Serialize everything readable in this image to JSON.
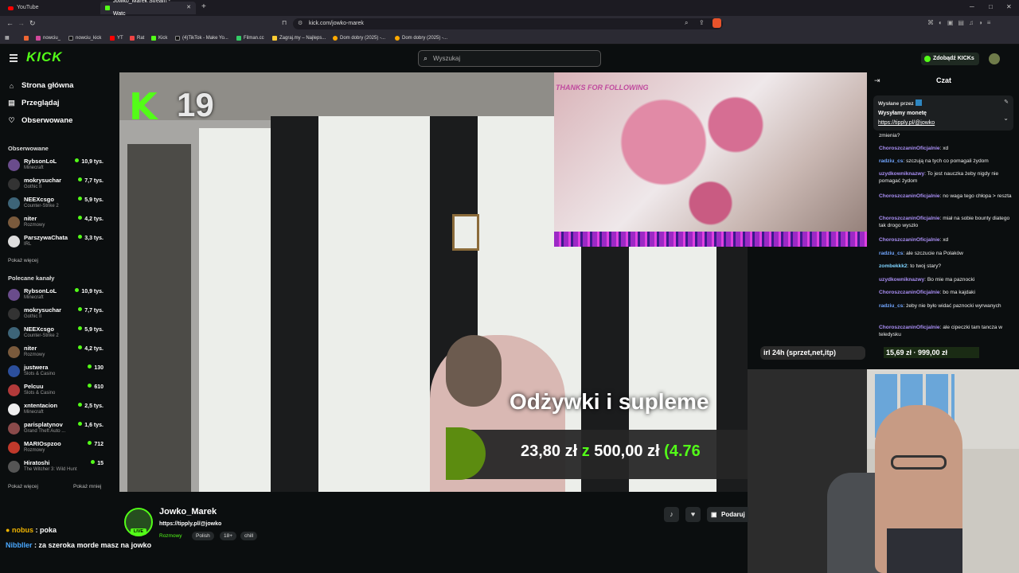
{
  "browser": {
    "tabs": [
      {
        "label": "YouTube",
        "active": false
      },
      {
        "label": "Jowko_Marek Stream - Watc",
        "active": true
      }
    ],
    "new_tab": "+",
    "url": "kick.com/jowko-marek",
    "bookmarks": [
      "nowciu_",
      "nowciu_kick",
      "YT",
      "Rat",
      "Kick",
      "(4)TikTok - Make Yo...",
      "Filman.cc",
      "Zagraj.my – Najleps...",
      "Dom dobry (2025) -...",
      "Dom dobry (2025) -..."
    ],
    "colors": {
      "kick_green": "#53fc18",
      "bg": "#0b0e0f"
    }
  },
  "header": {
    "logo": "KICK",
    "search_placeholder": "Wyszukaj",
    "kicks_button": "Zdobądź KICKs"
  },
  "sidebar": {
    "nav": [
      {
        "label": "Strona główna",
        "icon": "home-icon"
      },
      {
        "label": "Przeglądaj",
        "icon": "browse-icon"
      },
      {
        "label": "Obserwowane",
        "icon": "heart-icon"
      }
    ],
    "followed_title": "Obserwowane",
    "followed": [
      {
        "name": "RybsonLoL",
        "game": "Minecraft",
        "viewers": "10,9 tys."
      },
      {
        "name": "mokrysuchar",
        "game": "Gothic II",
        "viewers": "7,7 tys."
      },
      {
        "name": "NEEXcsgo",
        "game": "Counter-Strike 2",
        "viewers": "5,9 tys."
      },
      {
        "name": "niter",
        "game": "Rozmowy",
        "viewers": "4,2 tys."
      },
      {
        "name": "ParszywaChata",
        "game": "IRL",
        "viewers": "3,3 tys."
      }
    ],
    "show_more": "Pokaż więcej",
    "recommended_title": "Polecane kanały",
    "recommended": [
      {
        "name": "RybsonLoL",
        "game": "Minecraft",
        "viewers": "10,9 tys."
      },
      {
        "name": "mokrysuchar",
        "game": "Gothic II",
        "viewers": "7,7 tys."
      },
      {
        "name": "NEEXcsgo",
        "game": "Counter-Strike 2",
        "viewers": "5,9 tys."
      },
      {
        "name": "niter",
        "game": "Rozmowy",
        "viewers": "4,2 tys."
      },
      {
        "name": "justwera",
        "game": "Slots & Casino",
        "viewers": "130"
      },
      {
        "name": "Pelcuu",
        "game": "Slots & Casino",
        "viewers": "610"
      },
      {
        "name": "xntentacion",
        "game": "Minecraft",
        "viewers": "2,5 tys."
      },
      {
        "name": "parisplatynov",
        "game": "Grand Theft Auto ...",
        "viewers": "1,6 tys."
      },
      {
        "name": "MARIOspzoo",
        "game": "Rozmowy",
        "viewers": "712"
      },
      {
        "name": "Hiratoshi",
        "game": "The Witcher 3: Wild Hunt",
        "viewers": "15"
      }
    ],
    "show_more2": "Pokaż więcej",
    "show_less": "Pokaż mniej"
  },
  "video": {
    "k_counter": "19",
    "goal_title": "Odżywki i supleme",
    "goal_current": "23,80 zł",
    "goal_z": "z",
    "goal_target": "500,00 zł",
    "goal_pct": "(4.76",
    "donate_pill": "irl 24h (sprzet,net,itp)",
    "overlay_text": "THANKS FOR FOLLOWING"
  },
  "chat": {
    "title": "Czat",
    "pinned_by": "Wysłane przez",
    "pinned_msg": "Wysyłamy monetę",
    "pinned_link": "https://tipply.pl/@jowko",
    "first_line": "zmienia?",
    "messages": [
      {
        "user": "ChoroszczaninOficjalnie",
        "text": ": xd",
        "c": "u1"
      },
      {
        "user": "radziu_cs",
        "text": ": szczują na tych co pomagali żydom",
        "c": "u2"
      },
      {
        "user": "uzydkowniknazwy",
        "text": ": To jest nauczka żeby nigdy nie pomagać żydom",
        "c": "u3"
      },
      {
        "user": "ChoroszczaninOficjalnie",
        "text": ": no waga tego chłopa > reszta",
        "c": "u1"
      },
      {
        "user": "ChoroszczaninOficjalnie",
        "text": ": miał na sobie bounty diatego tak drogo wyszło",
        "c": "u1"
      },
      {
        "user": "ChoroszczaninOficjalnie",
        "text": ": xd",
        "c": "u1"
      },
      {
        "user": "radziu_cs",
        "text": ": ale szczucie na Polaków",
        "c": "u2"
      },
      {
        "user": "zombekkk2",
        "text": ": to twoj stary?",
        "c": "u4"
      },
      {
        "user": "uzydkowniknazwy",
        "text": ": Bo mie ma paznocki",
        "c": "u3"
      },
      {
        "user": "ChoroszczaninOficjalnie",
        "text": ": bo ma kajdaki",
        "c": "u1"
      },
      {
        "user": "radziu_cs",
        "text": ": żeby nie było widać paznocki wyrwanych",
        "c": "u2"
      },
      {
        "user": "ChoroszczaninOficjalnie",
        "text": ": ale cipeczki tam tancza w teledysku",
        "c": "u1"
      }
    ],
    "bottom_amounts": "15,69 zł · 999,00 zł"
  },
  "streamer": {
    "name": "Jowko_Marek",
    "link": "https://tipply.pl/@jowko",
    "live": "LIVE",
    "category": "Rozmowy",
    "tags": [
      "Polish",
      "18+",
      "chill"
    ],
    "podaruj": "Podaruj"
  },
  "overlay_chat": [
    {
      "user": "nobus",
      "text": " : poka",
      "color": "#f0b400"
    },
    {
      "user": "Nibbller",
      "text": " : za szeroka morde masz na jowko",
      "color": "#4aa8ff"
    }
  ]
}
